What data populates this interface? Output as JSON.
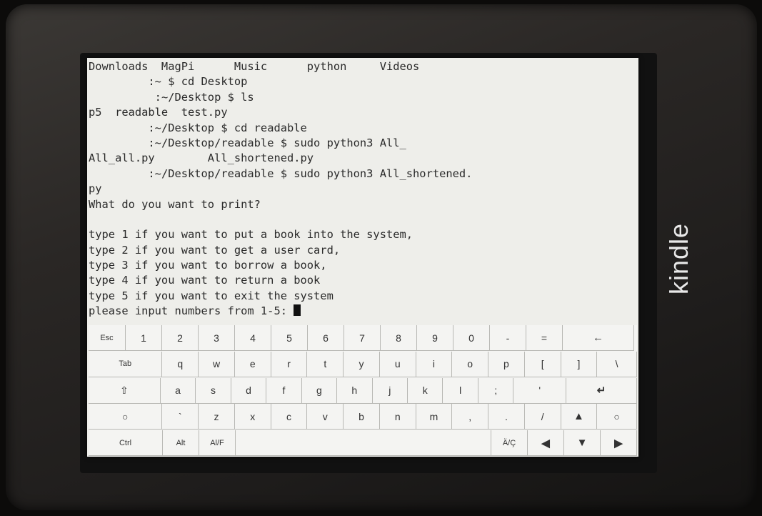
{
  "device": {
    "brand": "kindle"
  },
  "terminal": {
    "lines": [
      {
        "faint": "",
        "text": "Downloads  MagPi      Music      python     Videos"
      },
      {
        "faint": "         ",
        "text": ":~ $ cd Desktop"
      },
      {
        "faint": "          ",
        "text": ":~/Desktop $ ls"
      },
      {
        "faint": "",
        "text": "p5  readable  test.py"
      },
      {
        "faint": "         ",
        "text": ":~/Desktop $ cd readable"
      },
      {
        "faint": "         ",
        "text": ":~/Desktop/readable $ sudo python3 All_"
      },
      {
        "faint": "",
        "text": "All_all.py        All_shortened.py"
      },
      {
        "faint": "         ",
        "text": ":~/Desktop/readable $ sudo python3 All_shortened."
      },
      {
        "faint": "",
        "text": "py"
      },
      {
        "faint": "",
        "text": "What do you want to print?"
      },
      {
        "faint": "",
        "text": ""
      },
      {
        "faint": "",
        "text": "type 1 if you want to put a book into the system,"
      },
      {
        "faint": "",
        "text": "type 2 if you want to get a user card,"
      },
      {
        "faint": "",
        "text": "type 3 if you want to borrow a book,"
      },
      {
        "faint": "",
        "text": "type 4 if you want to return a book"
      },
      {
        "faint": "",
        "text": "type 5 if you want to exit the system"
      }
    ],
    "prompt": "please input numbers from 1-5: "
  },
  "keyboard": {
    "row1": [
      "Esc",
      "1",
      "2",
      "3",
      "4",
      "5",
      "6",
      "7",
      "8",
      "9",
      "0",
      "-",
      "=",
      "←"
    ],
    "row2": [
      "Tab",
      "q",
      "w",
      "e",
      "r",
      "t",
      "y",
      "u",
      "i",
      "o",
      "p",
      "[",
      "]",
      "\\"
    ],
    "row3": [
      "⇧",
      "a",
      "s",
      "d",
      "f",
      "g",
      "h",
      "j",
      "k",
      "l",
      ";",
      "'",
      "↵"
    ],
    "row4": [
      "○",
      "`",
      "z",
      "x",
      "c",
      "v",
      "b",
      "n",
      "m",
      ",",
      ".",
      "/",
      "▲",
      "○"
    ],
    "row5": [
      "Ctrl",
      "Alt",
      "Al/F",
      "",
      "Ä/Ç",
      "◀",
      "▼",
      "▶"
    ]
  }
}
